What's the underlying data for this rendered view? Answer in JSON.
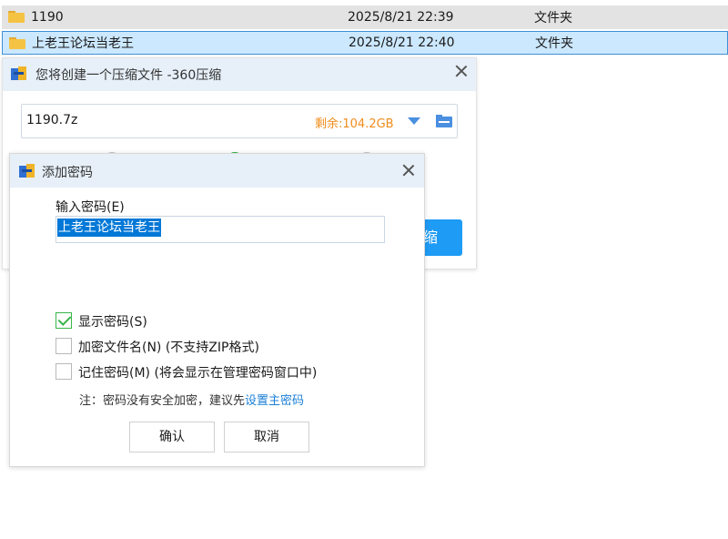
{
  "explorer": {
    "rows": [
      {
        "name": "1190",
        "date": "2025/8/21 22:39",
        "type": "文件夹"
      },
      {
        "name": "上老王论坛当老王",
        "date": "2025/8/21 22:40",
        "type": "文件夹"
      }
    ]
  },
  "compress_dialog": {
    "title": "您将创建一个压缩文件 -360压缩",
    "filename": "1190.7z",
    "free_space": "剩余:104.2GB",
    "compress_button_partial": "缩"
  },
  "password_dialog": {
    "title": "添加密码",
    "input_label": "输入密码(E)",
    "password_value": "上老王论坛当老王",
    "options": [
      {
        "label": "显示密码(S)",
        "checked": true
      },
      {
        "label": "加密文件名(N) (不支持ZIP格式)",
        "checked": false
      },
      {
        "label": "记住密码(M) (将会显示在管理密码窗口中)",
        "checked": false
      }
    ],
    "note_prefix": "注：密码没有安全加密，建议先",
    "note_link": "设置主密码",
    "ok_label": "确认",
    "cancel_label": "取消"
  },
  "colors": {
    "accent": "#1e9bf5",
    "free_space": "#f08c1b",
    "check": "#39b54a",
    "selection": "#0078d7"
  }
}
